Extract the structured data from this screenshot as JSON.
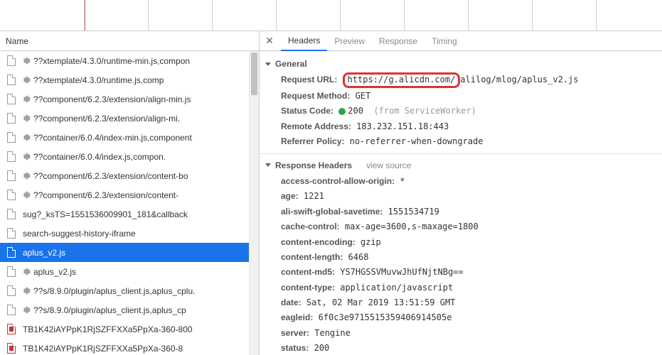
{
  "left": {
    "header": "Name",
    "items": [
      {
        "gear": true,
        "name": "??xtemplate/4.3.0/runtime-min.js,compon"
      },
      {
        "gear": true,
        "name": "??xtemplate/4.3.0/runtime.js,comp"
      },
      {
        "gear": true,
        "name": "??component/6.2.3/extension/align-min.js"
      },
      {
        "gear": true,
        "name": "??component/6.2.3/extension/align-mi."
      },
      {
        "gear": true,
        "name": "??container/6.0.4/index-min.js,component"
      },
      {
        "gear": true,
        "name": "??container/6.0.4/index.js,compon."
      },
      {
        "gear": true,
        "name": "??component/6.2.3/extension/content-bo"
      },
      {
        "gear": true,
        "name": "??component/6.2.3/extension/content-"
      },
      {
        "gear": false,
        "name": "sug?_ksTS=1551536009901_181&callback"
      },
      {
        "gear": false,
        "name": "search-suggest-history-iframe"
      },
      {
        "gear": false,
        "name": "aplus_v2.js",
        "selected": true
      },
      {
        "gear": true,
        "name": "aplus_v2.js"
      },
      {
        "gear": true,
        "name": "??s/8.9.0/plugin/aplus_client.js,aplus_cplu."
      },
      {
        "gear": true,
        "name": "??s/8.9.0/plugin/aplus_client.js,aplus_cp"
      },
      {
        "gear": false,
        "red": true,
        "name": "TB1K42iAYPpK1RjSZFFXXa5PpXa-360-800"
      },
      {
        "gear": false,
        "red": true,
        "name": "TB1K42iAYPpK1RjSZFFXXa5PpXa-360-8"
      }
    ]
  },
  "tabs": {
    "items": [
      {
        "label": "Headers",
        "active": true
      },
      {
        "label": "Preview"
      },
      {
        "label": "Response"
      },
      {
        "label": "Timing"
      }
    ]
  },
  "general": {
    "title": "General",
    "request_url_k": "Request URL:",
    "request_url_host": "https://g.alicdn.com/",
    "request_url_rest": "alilog/mlog/aplus_v2.js",
    "request_method_k": "Request Method:",
    "request_method_v": "GET",
    "status_code_k": "Status Code:",
    "status_code_v": "200",
    "status_code_note": "(from ServiceWorker)",
    "remote_addr_k": "Remote Address:",
    "remote_addr_v": "183.232.151.18:443",
    "referrer_k": "Referrer Policy:",
    "referrer_v": "no-referrer-when-downgrade"
  },
  "response_headers": {
    "title": "Response Headers",
    "view_source": "view source",
    "rows": [
      {
        "k": "access-control-allow-origin:",
        "v": "*"
      },
      {
        "k": "age:",
        "v": "1221"
      },
      {
        "k": "ali-swift-global-savetime:",
        "v": "1551534719"
      },
      {
        "k": "cache-control:",
        "v": "max-age=3600,s-maxage=1800"
      },
      {
        "k": "content-encoding:",
        "v": "gzip"
      },
      {
        "k": "content-length:",
        "v": "6468"
      },
      {
        "k": "content-md5:",
        "v": "YS7HGSSVMuvwJhUfNjtNBg=="
      },
      {
        "k": "content-type:",
        "v": "application/javascript"
      },
      {
        "k": "date:",
        "v": "Sat, 02 Mar 2019 13:51:59 GMT"
      },
      {
        "k": "eagleid:",
        "v": "6f0c3e9715515359406914505e"
      },
      {
        "k": "server:",
        "v": "Tengine"
      },
      {
        "k": "status:",
        "v": "200"
      }
    ]
  }
}
